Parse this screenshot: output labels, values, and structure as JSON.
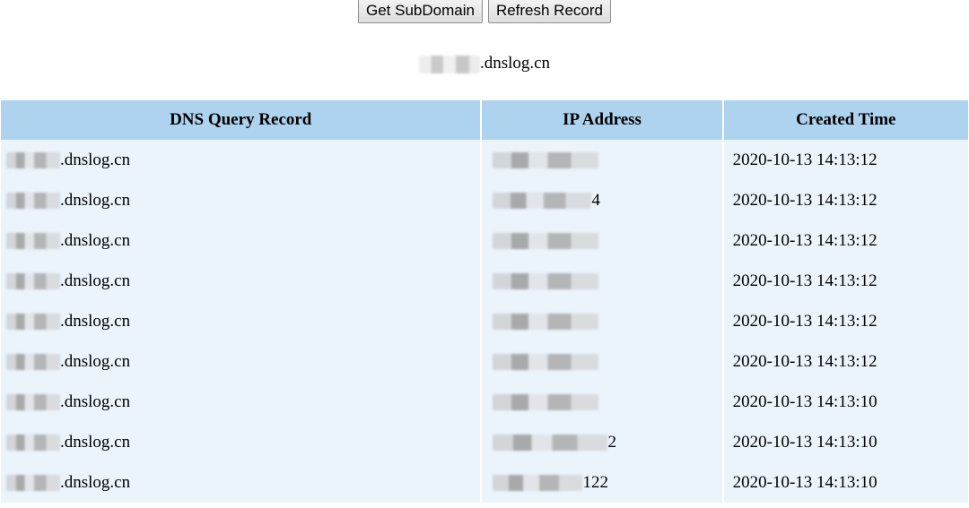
{
  "toolbar": {
    "get_subdomain_label": "Get SubDomain",
    "refresh_record_label": "Refresh Record"
  },
  "subdomain": {
    "suffix": ".dnslog.cn"
  },
  "table": {
    "headers": [
      "DNS Query Record",
      "IP Address",
      "Created Time"
    ],
    "header_bg": "#aed3ef",
    "row_bg": "#ebf3fb",
    "rows": [
      {
        "dns_suffix": ".dnslog.cn",
        "ip_visible_tail": "",
        "created": "2020-10-13 14:13:12"
      },
      {
        "dns_suffix": ".dnslog.cn",
        "ip_visible_tail": "4",
        "created": "2020-10-13 14:13:12"
      },
      {
        "dns_suffix": ".dnslog.cn",
        "ip_visible_tail": "",
        "created": "2020-10-13 14:13:12"
      },
      {
        "dns_suffix": ".dnslog.cn",
        "ip_visible_tail": "",
        "created": "2020-10-13 14:13:12"
      },
      {
        "dns_suffix": ".dnslog.cn",
        "ip_visible_tail": "",
        "created": "2020-10-13 14:13:12"
      },
      {
        "dns_suffix": ".dnslog.cn",
        "ip_visible_tail": "",
        "created": "2020-10-13 14:13:12"
      },
      {
        "dns_suffix": ".dnslog.cn",
        "ip_visible_tail": "",
        "created": "2020-10-13 14:13:10"
      },
      {
        "dns_suffix": ".dnslog.cn",
        "ip_visible_tail": "2",
        "created": "2020-10-13 14:13:10"
      },
      {
        "dns_suffix": ".dnslog.cn",
        "ip_visible_tail": "122",
        "created": "2020-10-13 14:13:10"
      }
    ]
  }
}
